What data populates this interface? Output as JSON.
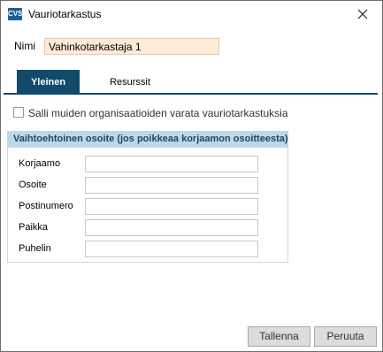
{
  "window": {
    "title": "Vauriotarkastus",
    "icon_text": "CVS",
    "icon": "app-icon",
    "close_icon": "close-icon"
  },
  "name": {
    "label": "Nimi",
    "value": "Vahinkotarkastaja 1"
  },
  "tabs": [
    {
      "label": "Yleinen",
      "active": true
    },
    {
      "label": "Resurssit",
      "active": false
    }
  ],
  "allow_other_orgs": {
    "label": "Salli muiden organisaatioiden varata vauriotarkastuksia",
    "checked": false
  },
  "alt_address": {
    "header": "Vaihtoehtoinen osoite (jos poikkeaa korjaamon osoitteesta)",
    "fields": [
      {
        "label": "Korjaamo",
        "value": ""
      },
      {
        "label": "Osoite",
        "value": ""
      },
      {
        "label": "Postinumero",
        "value": ""
      },
      {
        "label": "Paikka",
        "value": ""
      },
      {
        "label": "Puhelin",
        "value": ""
      }
    ]
  },
  "buttons": {
    "save": "Tallenna",
    "cancel": "Peruuta"
  },
  "colors": {
    "tab_active": "#114a6b",
    "group_header_bg": "#bfd7e6",
    "name_input_bg": "#fdebd8"
  }
}
